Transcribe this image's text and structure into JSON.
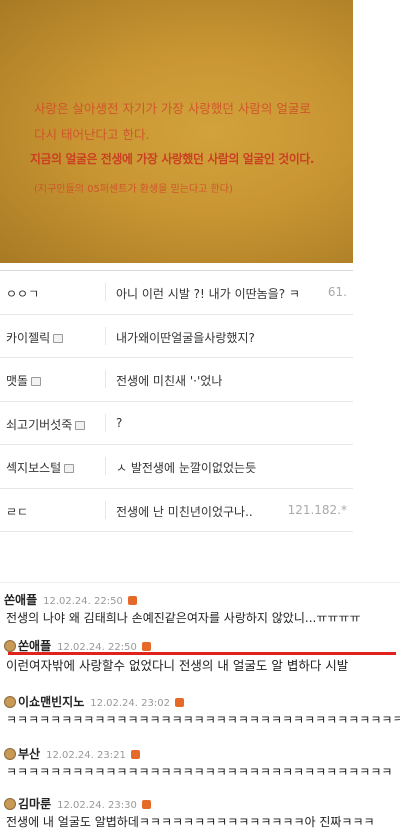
{
  "photo": {
    "line1": "사랑은 살아생전 자기가 가장 사랑했던 사람의 얼굴로",
    "line2": "다시 태어난다고 한다.",
    "line3": "지금의 얼굴은 전생에 가장 사랑했던 사람의 얼굴인 것이다.",
    "line4": "(지구인들의 05퍼센트가 환생을 믿는다고 한다)"
  },
  "table": {
    "rows": [
      {
        "nick": "ㅇㅇㄱ",
        "text": "아니 이런 시발 ?! 내가 이딴놈을? ㅋ",
        "ip": "61."
      },
      {
        "nick": "카이젤릭",
        "text": "내가왜이딴얼굴을사랑했지?",
        "ip": ""
      },
      {
        "nick": "맷돌",
        "text": "전생에 미친새 '·'었나",
        "ip": ""
      },
      {
        "nick": "쇠고기버섯죽",
        "text": "?",
        "ip": ""
      },
      {
        "nick": "섹지보스털",
        "text": "ㅅ 발전생에 눈깔이없었는듯",
        "ip": ""
      },
      {
        "nick": "ㄹㄷ",
        "text": "전생에 난 미친년이었구나..",
        "ip": "121.182.*"
      }
    ]
  },
  "comments": [
    {
      "name": "쏜애플",
      "date": "12.02.24. 22:50",
      "body": "전생의 나야 왜 김태희나 손예진같은여자를 사랑하지 않았니...ㅠㅠㅠㅠ"
    },
    {
      "name": "쏜애플",
      "date": "12.02.24. 22:50",
      "body": "이런여자밖에 사랑할수 없었다니 전생의 내 얼굴도 알 볍하다 시발"
    },
    {
      "name": "이쇼맨빈지노",
      "date": "12.02.24. 23:02",
      "body": "ㅋㅋㅋㅋㅋㅋㅋㅋㅋㅋㅋㅋㅋㅋㅋㅋㅋㅋㅋㅋㅋㅋㅋㅋㅋㅋㅋㅋㅋㅋㅋㅋㅋㅋㅋㅋㅋ"
    },
    {
      "name": "부산",
      "date": "12.02.24. 23:21",
      "body": "ㅋㅋㅋㅋㅋㅋㅋㅋㅋㅋㅋㅋㅋㅋㅋㅋㅋㅋㅋㅋㅋㅋㅋㅋㅋㅋㅋㅋㅋㅋㅋㅋㅋㅋㅋ"
    },
    {
      "name": "김마룬",
      "date": "12.02.24. 23:30",
      "body": "전생에 내 얼굴도 알볍하데ㅋㅋㅋㅋㅋㅋㅋㅋㅋㅋㅋㅋㅋㅋㅋ아 진짜ㅋㅋㅋ"
    }
  ],
  "colors": {
    "highlight_underline": "#e0211c",
    "photo_text": "#d24a2a"
  }
}
